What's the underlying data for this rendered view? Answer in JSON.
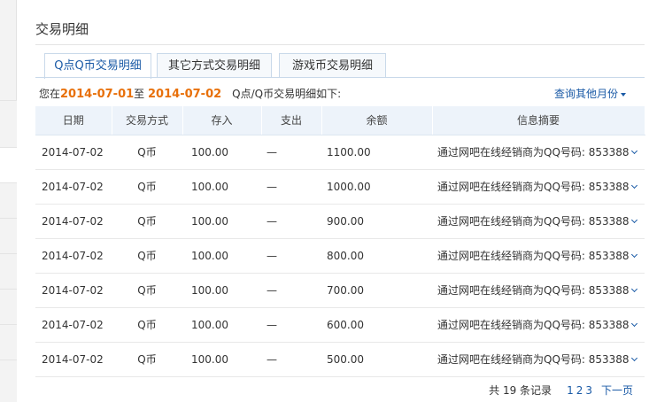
{
  "title": "交易明细",
  "tabs": [
    {
      "label": "Q点Q币交易明细",
      "active": true
    },
    {
      "label": "其它方式交易明细",
      "active": false
    },
    {
      "label": "游戏币交易明细",
      "active": false
    }
  ],
  "summary": {
    "prefix": "您在",
    "start_date": "2014-07-01",
    "to": "至",
    "end_date": "2014-07-02",
    "suffix": "Q点/Q币交易明细如下:"
  },
  "query_other_month": "查询其他月份",
  "table": {
    "headers": [
      "日期",
      "交易方式",
      "存入",
      "支出",
      "余额",
      "信息摘要"
    ],
    "rows": [
      {
        "date": "2014-07-02",
        "mode": "Q币",
        "in": "100.00",
        "out": "—",
        "balance": "1100.00",
        "info": "通过网吧在线经销商为QQ号码: 853388"
      },
      {
        "date": "2014-07-02",
        "mode": "Q币",
        "in": "100.00",
        "out": "—",
        "balance": "1000.00",
        "info": "通过网吧在线经销商为QQ号码: 853388"
      },
      {
        "date": "2014-07-02",
        "mode": "Q币",
        "in": "100.00",
        "out": "—",
        "balance": "900.00",
        "info": "通过网吧在线经销商为QQ号码: 853388"
      },
      {
        "date": "2014-07-02",
        "mode": "Q币",
        "in": "100.00",
        "out": "—",
        "balance": "800.00",
        "info": "通过网吧在线经销商为QQ号码: 853388"
      },
      {
        "date": "2014-07-02",
        "mode": "Q币",
        "in": "100.00",
        "out": "—",
        "balance": "700.00",
        "info": "通过网吧在线经销商为QQ号码: 853388"
      },
      {
        "date": "2014-07-02",
        "mode": "Q币",
        "in": "100.00",
        "out": "—",
        "balance": "600.00",
        "info": "通过网吧在线经销商为QQ号码: 853388"
      },
      {
        "date": "2014-07-02",
        "mode": "Q币",
        "in": "100.00",
        "out": "—",
        "balance": "500.00",
        "info": "通过网吧在线经销商为QQ号码: 853388"
      }
    ]
  },
  "pagination": {
    "total_text": "共 19 条记录",
    "pages": [
      "1",
      "2",
      "3"
    ],
    "next": "下一页"
  },
  "colors": {
    "accent": "#1a5aa6",
    "date_highlight": "#e8700a",
    "header_bg": "#edf3fa"
  }
}
